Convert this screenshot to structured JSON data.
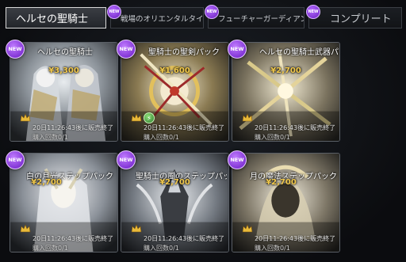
{
  "tabs": [
    {
      "label": "ヘルセの聖騎士",
      "active": true
    },
    {
      "label": "戦場のオリエンタルタイガー",
      "active": false,
      "badge": "NEW"
    },
    {
      "label": "フューチャーガーディアン",
      "active": false,
      "badge": "NEW"
    },
    {
      "label": "コンプリート",
      "active": false,
      "badge": "NEW"
    }
  ],
  "new_badge_label": "NEW",
  "cards": [
    {
      "title": "ヘルセの聖騎士",
      "price": "¥3,300",
      "timer": "20日11:26:43後に販売終了",
      "count": "購入回数0/1"
    },
    {
      "title": "聖騎士の聖剣パック",
      "price": "¥1,600",
      "timer": "20日11:26:43後に販売終了",
      "count": "購入回数0/1"
    },
    {
      "title": "ヘルセの聖騎士武器パック",
      "price": "¥2,700",
      "timer": "20日11:26:43後に販売終了",
      "count": "購入回数0/1"
    },
    {
      "title": "白の月光ステップパック",
      "price": "¥2,700",
      "timer": "20日11:26:43後に販売終了",
      "count": "購入回数0/1"
    },
    {
      "title": "聖騎士の風のステップパック",
      "price": "¥2,700",
      "timer": "20日11:26:43後に販売終了",
      "count": "購入回数0/1"
    },
    {
      "title": "月の魔法ステップパック",
      "price": "¥2,700",
      "timer": "20日11:26:43後に販売終了",
      "count": "購入回数0/1"
    }
  ],
  "colors": {
    "price": "#f2c94c",
    "new_badge": "#8a3fe0",
    "active_tab_border": "#d9d9d9"
  }
}
